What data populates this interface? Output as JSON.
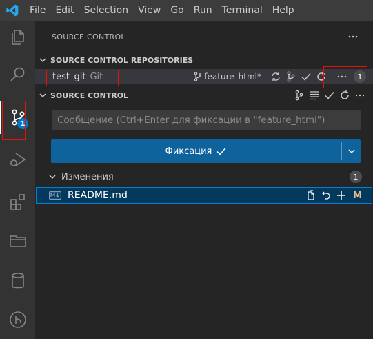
{
  "menu": [
    "File",
    "Edit",
    "Selection",
    "View",
    "Go",
    "Run",
    "Terminal",
    "Help"
  ],
  "activity": {
    "items": [
      "explorer-icon",
      "search-icon",
      "source-control-icon",
      "run-debug-icon",
      "extensions-icon",
      "remote-explorer-icon",
      "database-icon",
      "git-graph-icon"
    ],
    "source_control_badge": "1"
  },
  "sidebar": {
    "title": "SOURCE CONTROL",
    "repositories_header": "SOURCE CONTROL REPOSITORIES",
    "repo": {
      "name": "test_git",
      "provider": "Git",
      "branch": "feature_html*",
      "count": "1"
    },
    "sc_header": "SOURCE CONTROL",
    "commit_message_placeholder": "Сообщение (Ctrl+Enter для фиксации в \"feature_html\")",
    "commit_button_label": "Фиксация",
    "changes": {
      "label": "Изменения",
      "count": "1",
      "files": [
        {
          "name": "README.md",
          "status": "M",
          "file_icon": "markdown-file-icon"
        }
      ]
    }
  },
  "colors": {
    "accent": "#007acc",
    "commit_button": "#0e639c",
    "selected_row": "#04395e",
    "highlight_border": "#e51400"
  }
}
